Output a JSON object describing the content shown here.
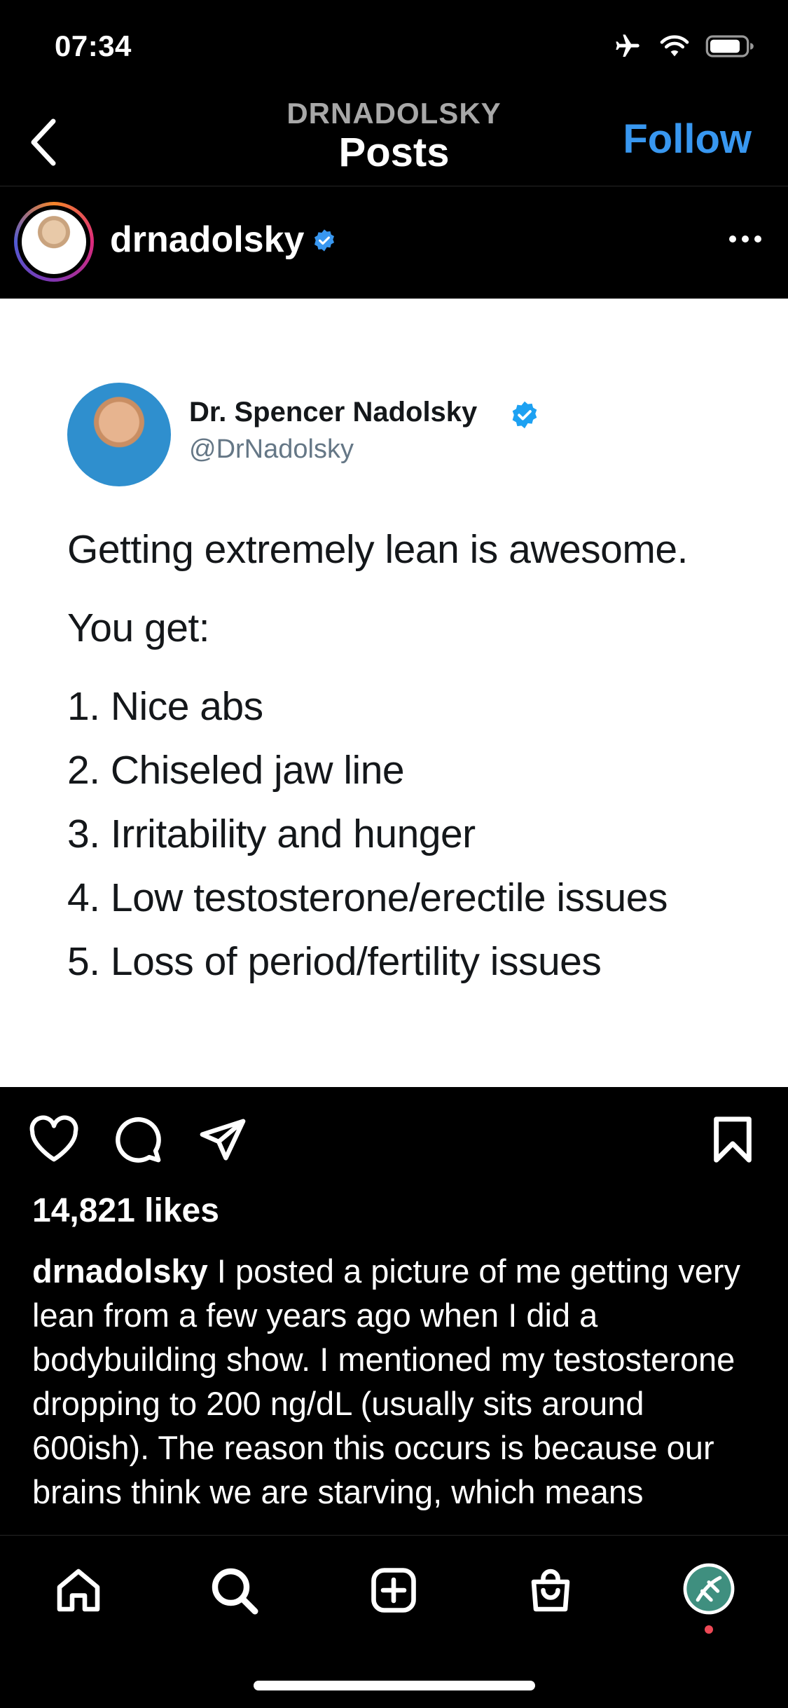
{
  "status_bar": {
    "time": "07:34"
  },
  "nav": {
    "username": "DRNADOLSKY",
    "title": "Posts",
    "follow_label": "Follow"
  },
  "post": {
    "username": "drnadolsky",
    "likes": "14,821 likes",
    "caption_username": "drnadolsky",
    "caption_text": " I posted a picture of me getting very lean from a few years ago when I did a bodybuilding show. I mentioned my testosterone dropping to 200 ng/dL (usually sits around 600ish). The reason this occurs is because our brains think we are starving, which means"
  },
  "tweet": {
    "name": "Dr. Spencer Nadolsky",
    "handle": "@DrNadolsky",
    "lines": [
      "Getting extremely lean is awesome.",
      "You get:",
      "1. Nice abs",
      "2. Chiseled jaw line",
      "3. Irritability and hunger",
      "4. Low testosterone/erectile issues",
      "5. Loss of period/fertility issues"
    ]
  },
  "icons": {
    "status": [
      "airplane-icon",
      "wifi-icon",
      "battery-icon"
    ],
    "actions": [
      "heart-icon",
      "comment-icon",
      "share-icon",
      "bookmark-icon"
    ],
    "tabs": [
      "home-icon",
      "search-icon",
      "create-icon",
      "shop-icon",
      "profile-icon"
    ]
  },
  "colors": {
    "accent": "#3897f0",
    "verified": "#3897f0",
    "notification_dot": "#ed4956"
  }
}
